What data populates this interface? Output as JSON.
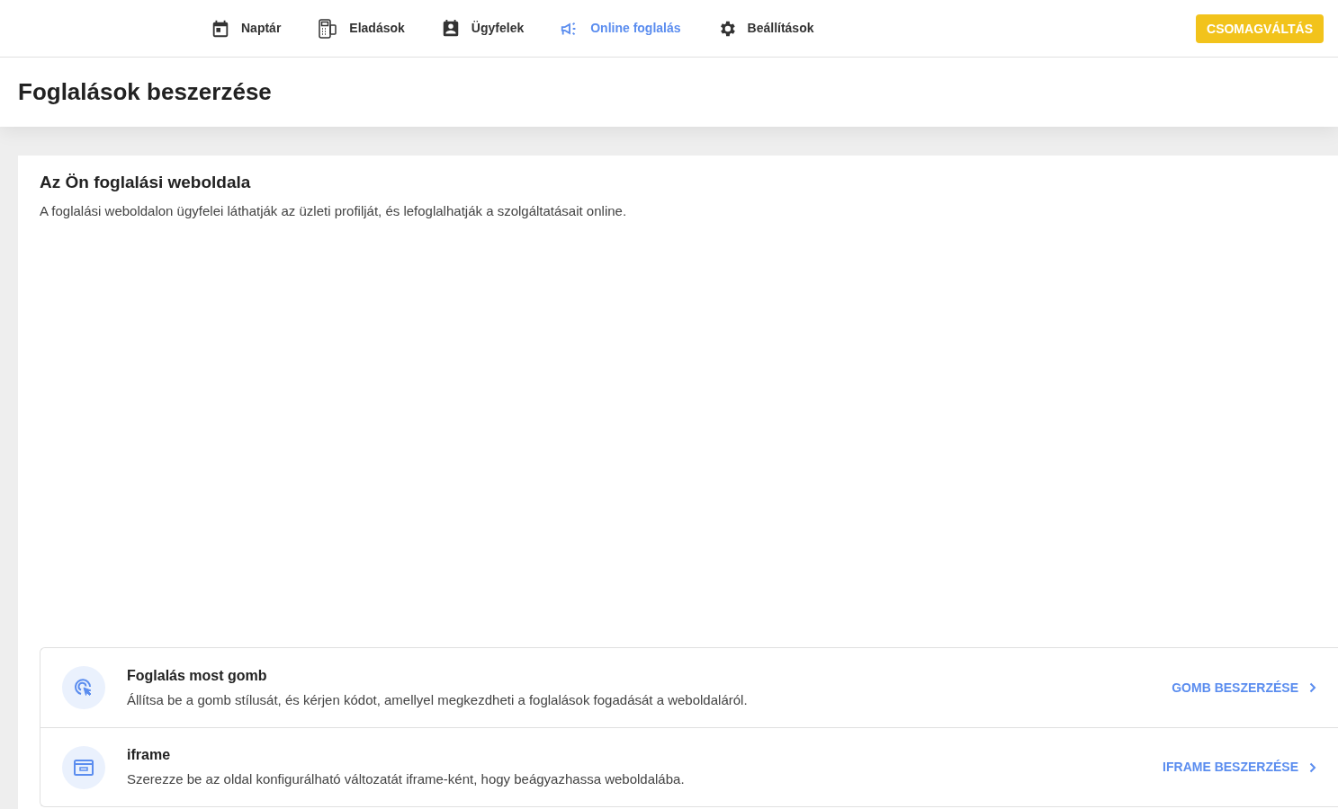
{
  "nav": {
    "items": [
      {
        "label": "Naptár",
        "selected": false
      },
      {
        "label": "Eladások",
        "selected": false
      },
      {
        "label": "Ügyfelek",
        "selected": false
      },
      {
        "label": "Online foglalás",
        "selected": true
      },
      {
        "label": "Beállítások",
        "selected": false
      }
    ],
    "upgrade_button": "CSOMAGVÁLTÁS"
  },
  "page_title": "Foglalások beszerzése",
  "card": {
    "title": "Az Ön foglalási weboldala",
    "description": "A foglalási weboldalon ügyfelei láthatják az üzleti profilját, és lefoglalhatják a szolgáltatásait online.",
    "options": [
      {
        "title": "Foglalás most gomb",
        "description": "Állítsa be a gomb stílusát, és kérjen kódot, amellyel megkezdheti a foglalások fogadását a weboldaláról.",
        "action": "GOMB BESZERZÉSE"
      },
      {
        "title": "iframe",
        "description": "Szerezze be az oldal konfigurálható változatát iframe-ként, hogy beágyazhassa weboldalába.",
        "action": "IFRAME BESZERZÉSE"
      }
    ]
  }
}
